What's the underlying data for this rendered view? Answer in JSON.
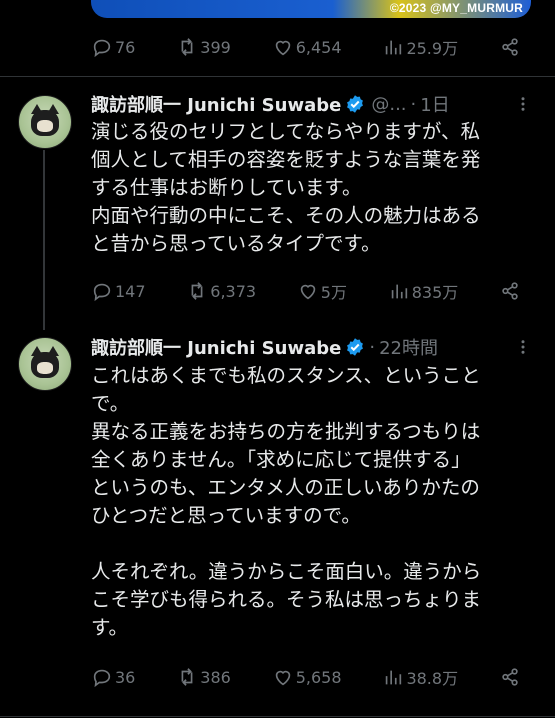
{
  "media": {
    "watermark": "©2023 @MY_MURMUR"
  },
  "tweets": [
    {
      "stats": {
        "replies": "76",
        "retweets": "399",
        "likes": "6,454",
        "views": "25.9万"
      }
    },
    {
      "author_name": "諏訪部順一 Junichi Suwabe",
      "handle": "@...",
      "time": "1日",
      "text": "演じる役のセリフとしてならやりますが、私\n個人として相手の容姿を貶すような言葉を発\nする仕事はお断りしています。\n内面や行動の中にこそ、その人の魅力はある\nと昔から思っているタイプです。",
      "stats": {
        "replies": "147",
        "retweets": "6,373",
        "likes": "5万",
        "views": "835万"
      }
    },
    {
      "author_name": "諏訪部順一 Junichi Suwabe",
      "handle": "",
      "time": "22時間",
      "text": "これはあくまでも私のスタンス、ということ\nで。\n異なる正義をお持ちの方を批判するつもりは\n全くありません。「求めに応じて提供する」\nというのも、エンタメ人の正しいありかたの\nひとつだと思っていますので。\n\n人それぞれ。違うからこそ面白い。違うから\nこそ学びも得られる。そう私は思っちょりま\nす。",
      "stats": {
        "replies": "36",
        "retweets": "386",
        "likes": "5,658",
        "views": "38.8万"
      }
    }
  ],
  "colors": {
    "background": "#000000",
    "text": "#e7e9ea",
    "muted": "#71767b",
    "verified": "#1d9bf0"
  },
  "icons": [
    "reply-icon",
    "retweet-icon",
    "like-icon",
    "views-icon",
    "share-icon",
    "verified-badge-icon",
    "more-icon"
  ]
}
